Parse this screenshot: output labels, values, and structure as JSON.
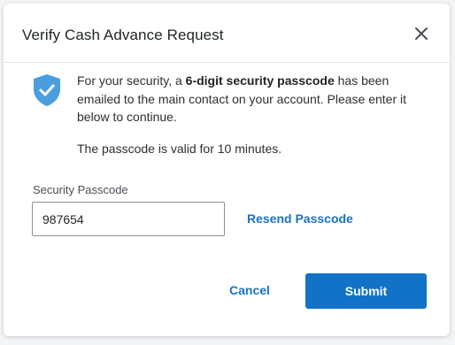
{
  "dialog": {
    "title": "Verify Cash Advance Request",
    "close_icon": "close-icon",
    "shield_icon": "shield-check-icon",
    "accent_color": "#1172c8",
    "message": {
      "part1": "For your security, a ",
      "bold": "6-digit security passcode",
      "part2": " has been emailed to the main contact on your account. Please enter it below to continue."
    },
    "validity_note": "The passcode is valid for 10 minutes.",
    "passcode_field": {
      "label": "Security Passcode",
      "value": "987654"
    },
    "resend_label": "Resend Passcode",
    "cancel_label": "Cancel",
    "submit_label": "Submit"
  }
}
